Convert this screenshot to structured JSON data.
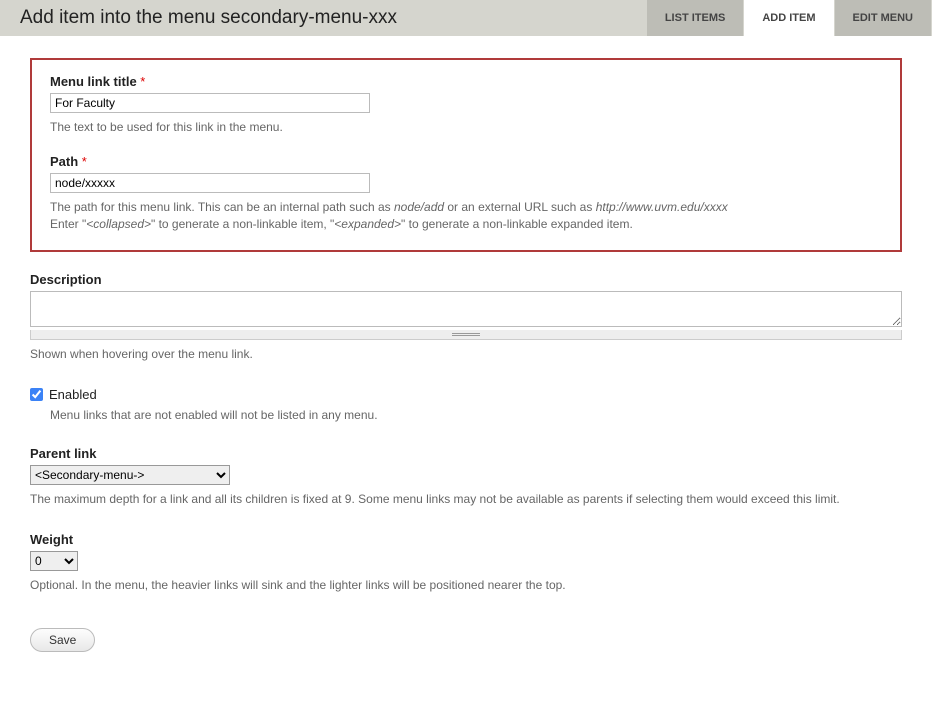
{
  "header": {
    "title": "Add item into the menu secondary-menu-xxx",
    "tabs": [
      {
        "label": "LIST ITEMS",
        "active": false
      },
      {
        "label": "ADD ITEM",
        "active": true
      },
      {
        "label": "EDIT MENU",
        "active": false
      }
    ]
  },
  "form": {
    "menu_link_title": {
      "label": "Menu link title",
      "value": "For Faculty",
      "hint": "The text to be used for this link in the menu."
    },
    "path": {
      "label": "Path",
      "value": "node/xxxxx",
      "hint_prefix": "The path for this menu link. This can be an internal path such as ",
      "hint_ital1": "node/add",
      "hint_mid": " or an external URL such as ",
      "hint_ital2": "http://www.uvm.edu/xxxx",
      "hint_line2_a": "Enter \"",
      "hint_line2_ital1": "<collapsed>",
      "hint_line2_b": "\" to generate a non-linkable item, \"",
      "hint_line2_ital2": "<expanded>",
      "hint_line2_c": "\" to generate a non-linkable expanded item."
    },
    "description": {
      "label": "Description",
      "value": "",
      "hint": "Shown when hovering over the menu link."
    },
    "enabled": {
      "label": "Enabled",
      "checked": true,
      "hint": "Menu links that are not enabled will not be listed in any menu."
    },
    "parent_link": {
      "label": "Parent link",
      "value": "<Secondary-menu->",
      "hint": "The maximum depth for a link and all its children is fixed at 9. Some menu links may not be available as parents if selecting them would exceed this limit."
    },
    "weight": {
      "label": "Weight",
      "value": "0",
      "hint": "Optional. In the menu, the heavier links will sink and the lighter links will be positioned nearer the top."
    },
    "save_label": "Save"
  }
}
